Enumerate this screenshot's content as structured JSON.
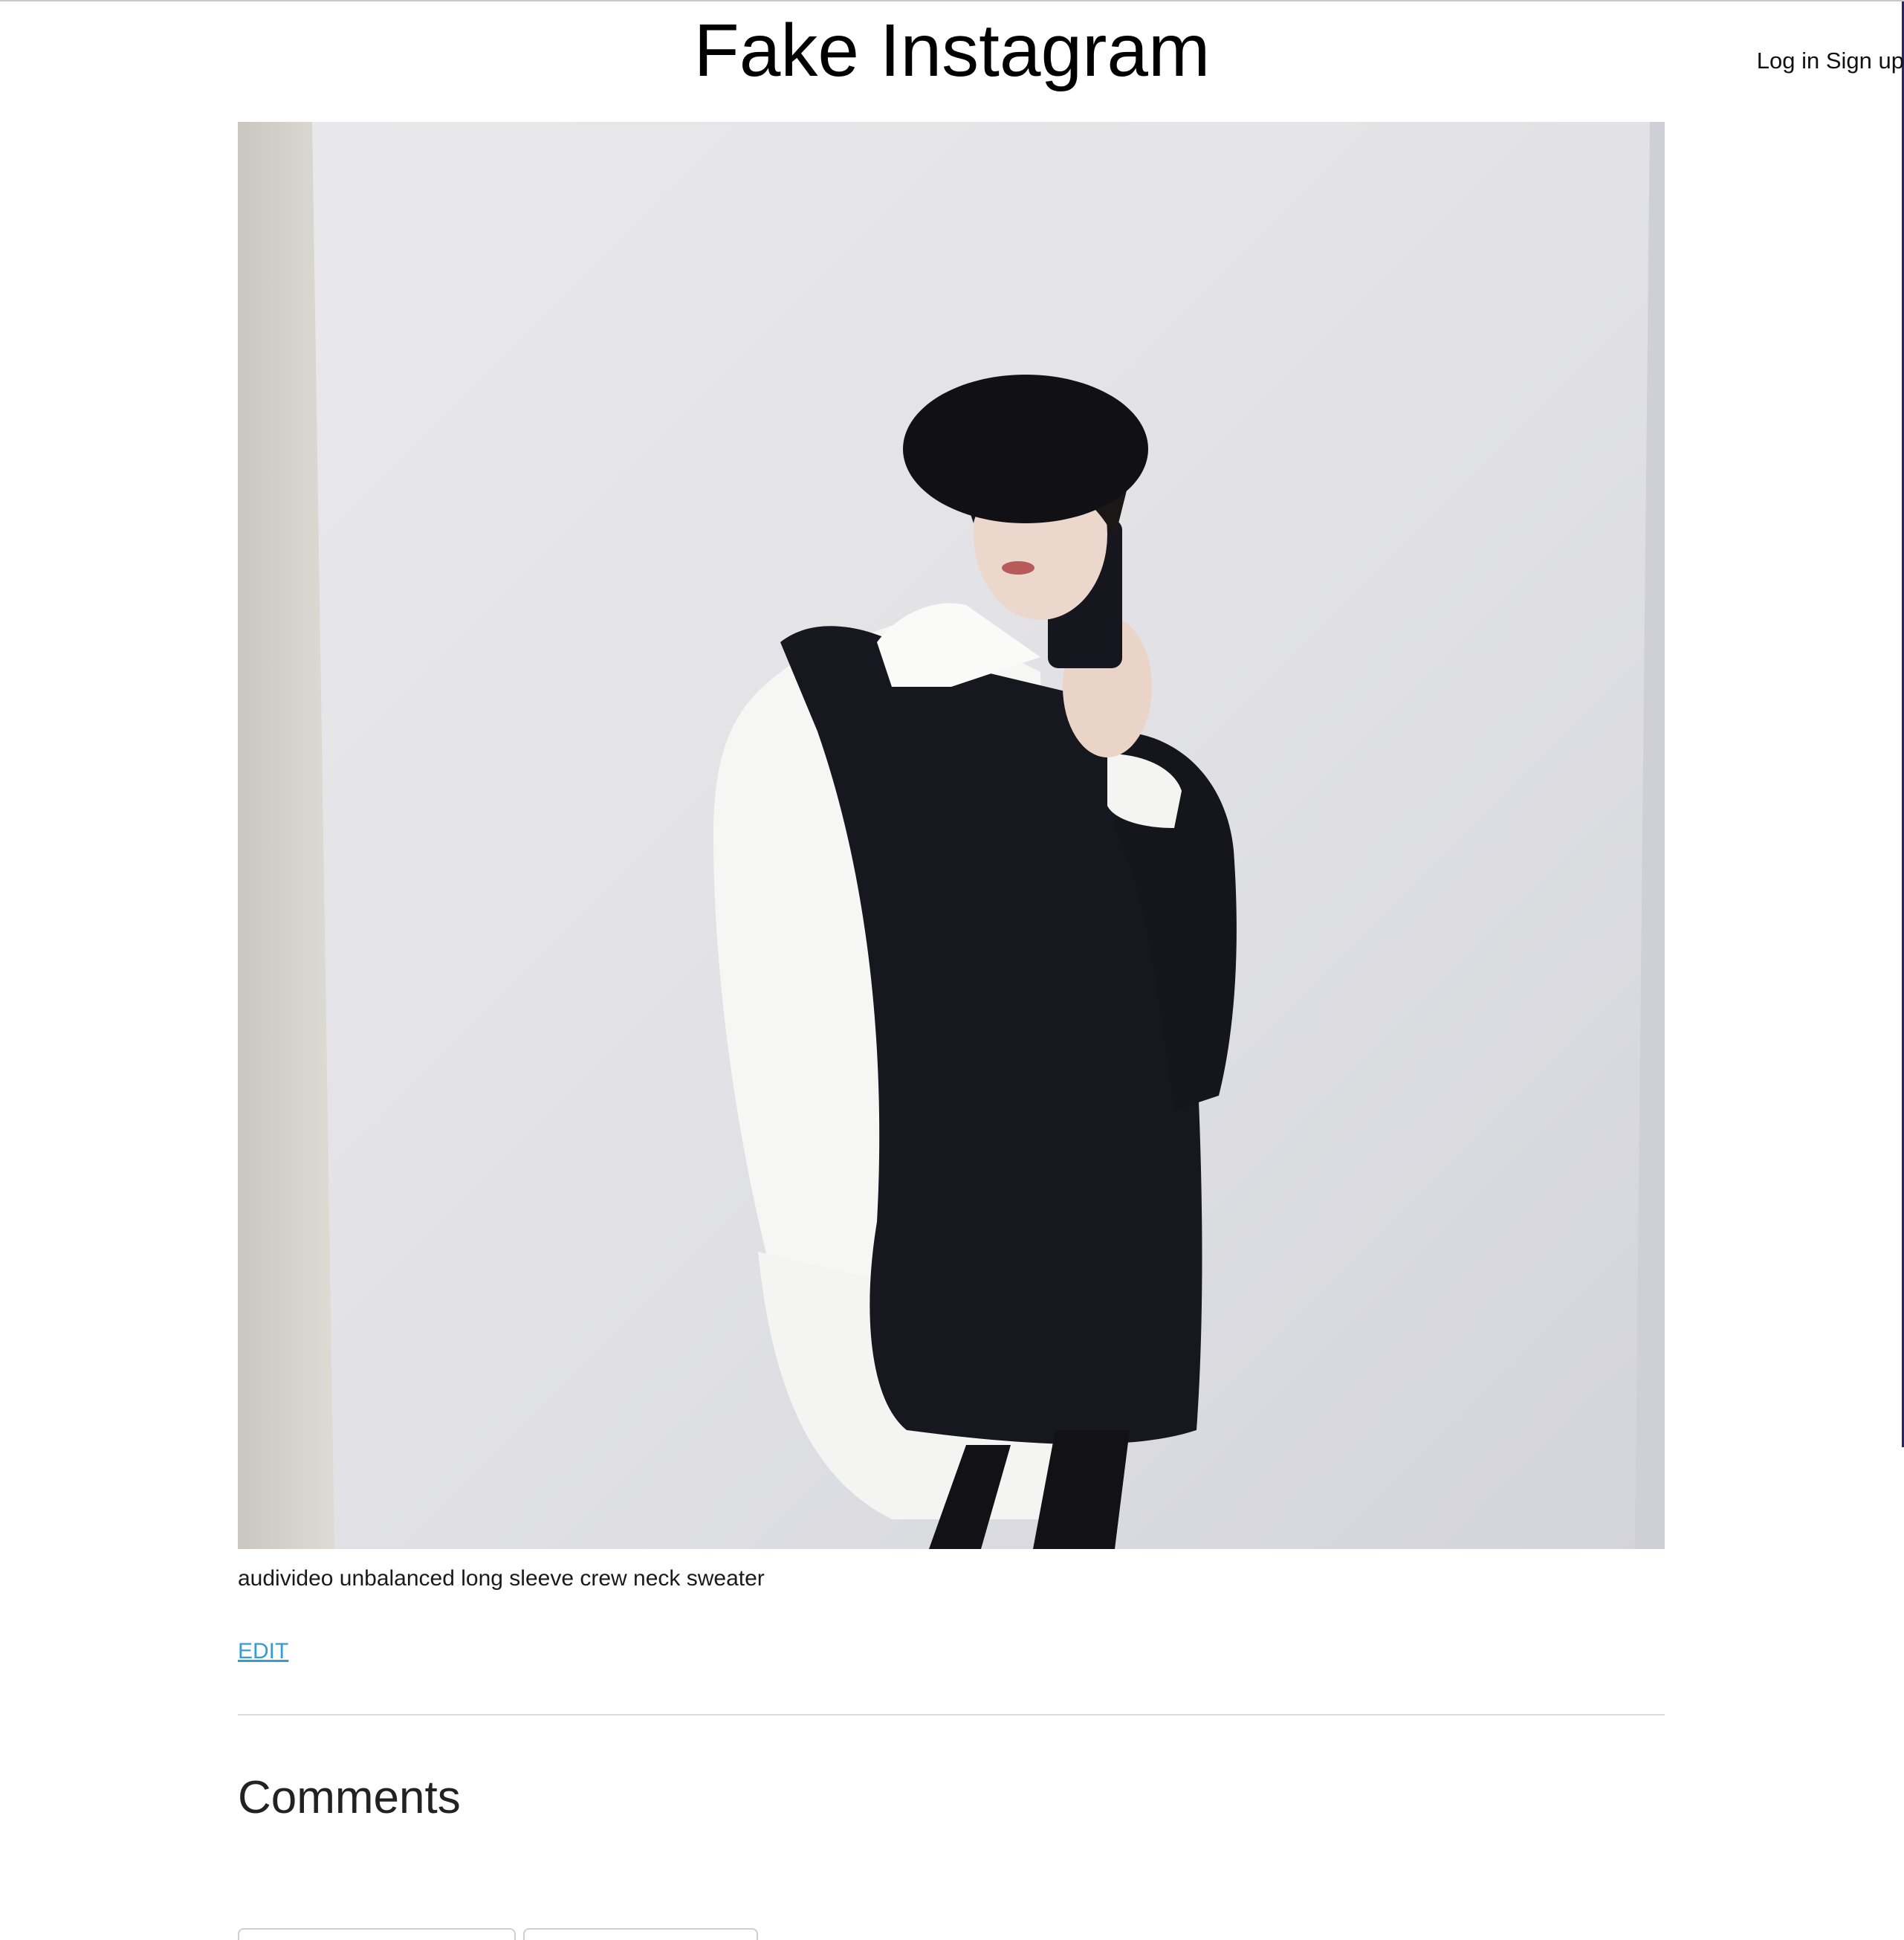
{
  "header": {
    "title": "Fake Instagram",
    "login_label": "Log in",
    "signup_label": "Sign up"
  },
  "post": {
    "caption": "audivideo unbalanced long sleeve crew neck sweater",
    "edit_label": "EDIT"
  },
  "comments": {
    "heading": "Comments"
  }
}
